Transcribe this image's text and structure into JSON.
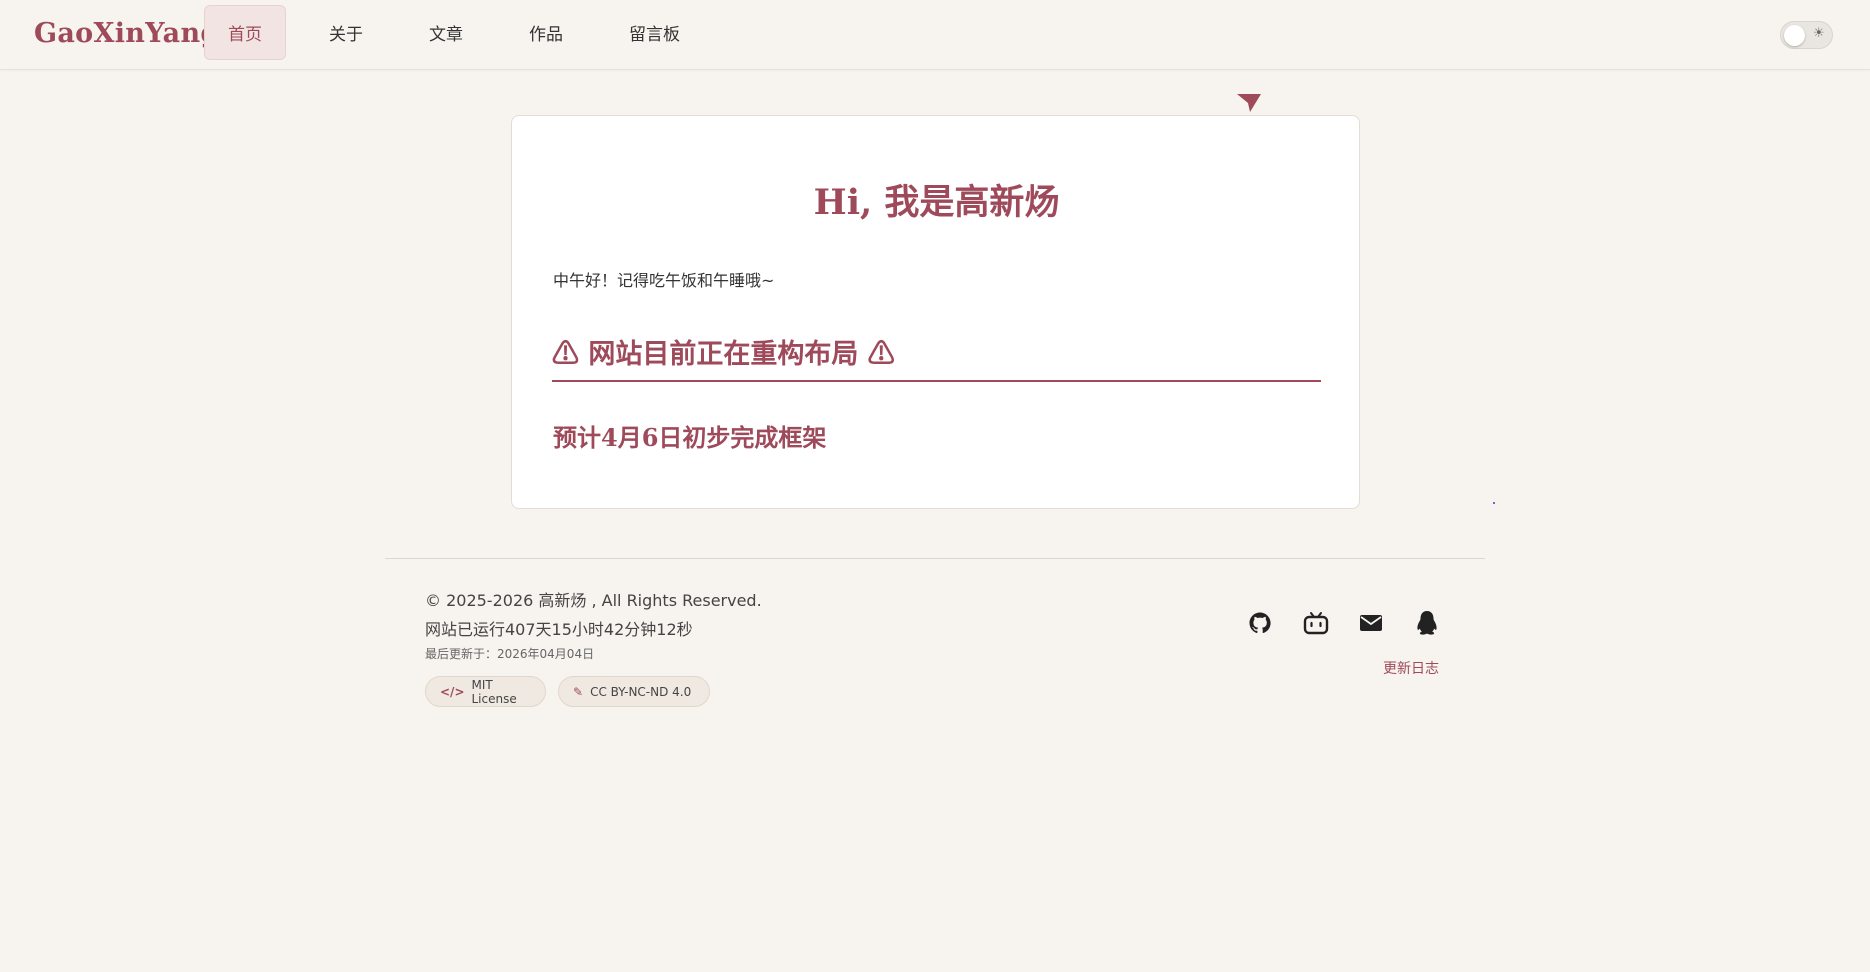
{
  "header": {
    "brand": "GaoXinYang",
    "nav": [
      {
        "label": "首页",
        "active": true
      },
      {
        "label": "关于"
      },
      {
        "label": "文章"
      },
      {
        "label": "作品"
      },
      {
        "label": "留言板"
      }
    ],
    "theme_toggle": {
      "icon": "sun-icon",
      "state": "light"
    }
  },
  "main": {
    "hero_title": "Hi, 我是高新炀",
    "greeting": "中午好！记得吃午饭和午睡哦~",
    "notice": "⚠ 网站目前正在重构布局 ⚠",
    "plan": "预计4月6日初步完成框架"
  },
  "footer": {
    "copyright": "© 2025-2026 高新炀 , All Rights Reserved.",
    "uptime": "网站已运行407天15小时42分钟12秒",
    "last_updated": "最后更新于：2026年04月04日",
    "badges": [
      {
        "icon": "code-icon",
        "label": "MIT License"
      },
      {
        "icon": "pen-icon",
        "label": "CC BY-NC-ND 4.0"
      }
    ],
    "social": [
      {
        "icon": "github-icon"
      },
      {
        "icon": "bilibili-icon"
      },
      {
        "icon": "mail-icon"
      },
      {
        "icon": "qq-icon"
      }
    ],
    "changelog": "更新日志"
  },
  "colors": {
    "accent": "#9e4a5a",
    "background": "#f7f4ef",
    "card": "#ffffff"
  }
}
